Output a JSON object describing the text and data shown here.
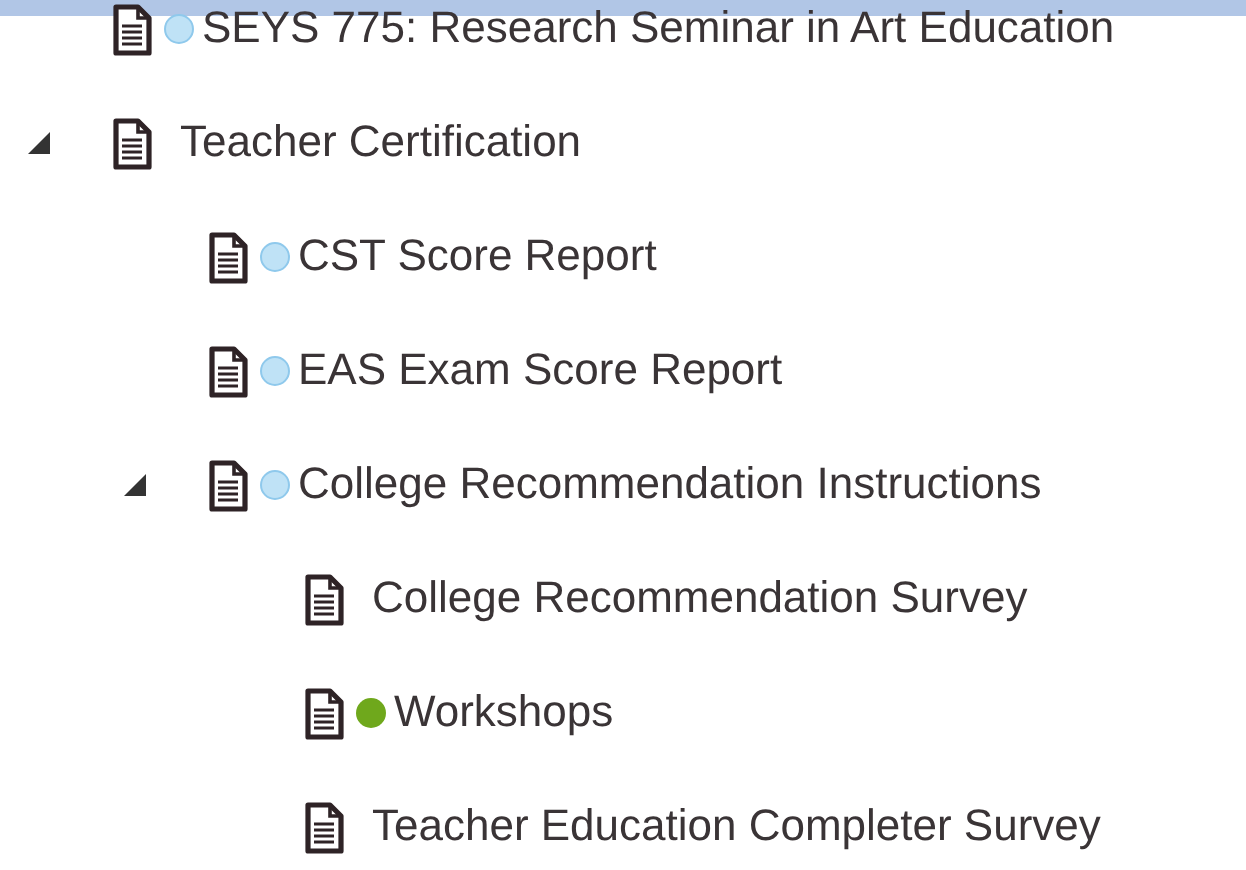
{
  "tree": [
    {
      "label": "SEYS 775: Research Seminar in Art Education",
      "color": "#bfe2f6"
    },
    {
      "label": "Teacher Certification",
      "expanded": true,
      "children": [
        {
          "label": "CST Score Report",
          "color": "#bfe2f6"
        },
        {
          "label": "EAS Exam Score Report",
          "color": "#bfe2f6"
        },
        {
          "label": "College Recommendation Instructions",
          "color": "#bfe2f6",
          "expanded": true,
          "children": [
            {
              "label": "College Recommendation Survey"
            },
            {
              "label": "Workshops",
              "color": "#6fa81c"
            },
            {
              "label": "Teacher Education Completer Survey"
            }
          ]
        }
      ]
    }
  ]
}
